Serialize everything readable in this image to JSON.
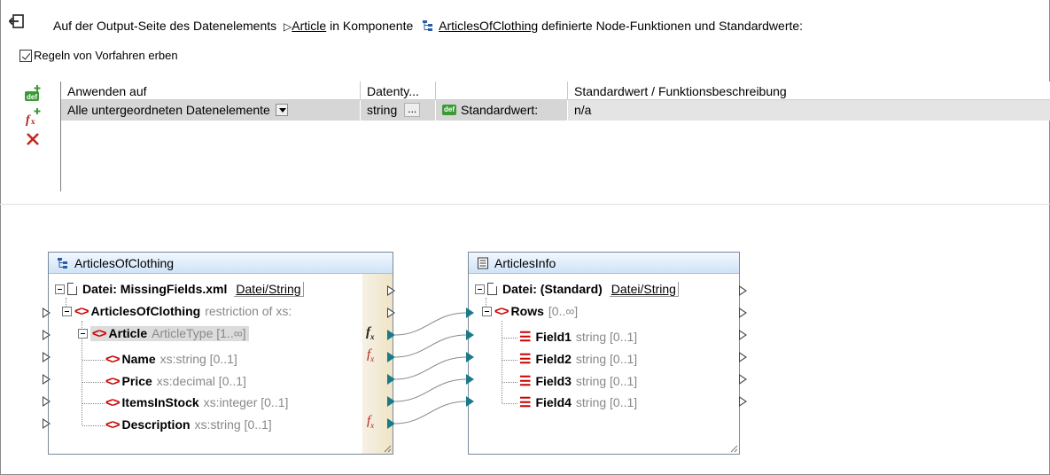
{
  "header": {
    "prefix": "Auf der Output-Seite des Datenelements",
    "item_name": "Article",
    "mid": "in Komponente",
    "component_name": "ArticlesOfClothing",
    "suffix": "definierte Node-Funktionen und Standardwerte:"
  },
  "inherit_rules": {
    "label": "Regeln von Vorfahren erben",
    "checked": true
  },
  "toolbar": {
    "add_default_icon": "def-plus-icon",
    "add_function_icon": "fx-plus-icon",
    "delete_icon": "close-icon"
  },
  "rules_table": {
    "columns": [
      "Anwenden auf",
      "Datenty...",
      "",
      "Standardwert / Funktionsbeschreibung"
    ],
    "rows": [
      {
        "apply_to": "Alle untergeordneten Datenelemente",
        "datatype": "string",
        "dots": "...",
        "kind_badge": "def",
        "kind_label": "Standardwert:",
        "value": "n/a"
      }
    ]
  },
  "source_component": {
    "title": "ArticlesOfClothing",
    "file_label": "Datei: MissingFields.xml",
    "file_button": "Datei/String",
    "nodes": [
      {
        "name": "ArticlesOfClothing",
        "type": "restriction of xs:"
      },
      {
        "name": "Article",
        "type": "ArticleType [1..∞]"
      },
      {
        "name": "Name",
        "type": "xs:string [0..1]"
      },
      {
        "name": "Price",
        "type": "xs:decimal [0..1]"
      },
      {
        "name": "ItemsInStock",
        "type": "xs:integer [0..1]"
      },
      {
        "name": "Description",
        "type": "xs:string [0..1]"
      }
    ]
  },
  "target_component": {
    "title": "ArticlesInfo",
    "file_label": "Datei: (Standard)",
    "file_button": "Datei/String",
    "nodes": [
      {
        "name": "Rows",
        "type": "[0..∞]"
      },
      {
        "name": "Field1",
        "type": "string [0..1]"
      },
      {
        "name": "Field2",
        "type": "string [0..1]"
      },
      {
        "name": "Field3",
        "type": "string [0..1]"
      },
      {
        "name": "Field4",
        "type": "string [0..1]"
      }
    ]
  },
  "colors": {
    "accent_port": "#1a7a8a",
    "element_icon": "#cc0000",
    "def_badge": "#3b9a35"
  }
}
